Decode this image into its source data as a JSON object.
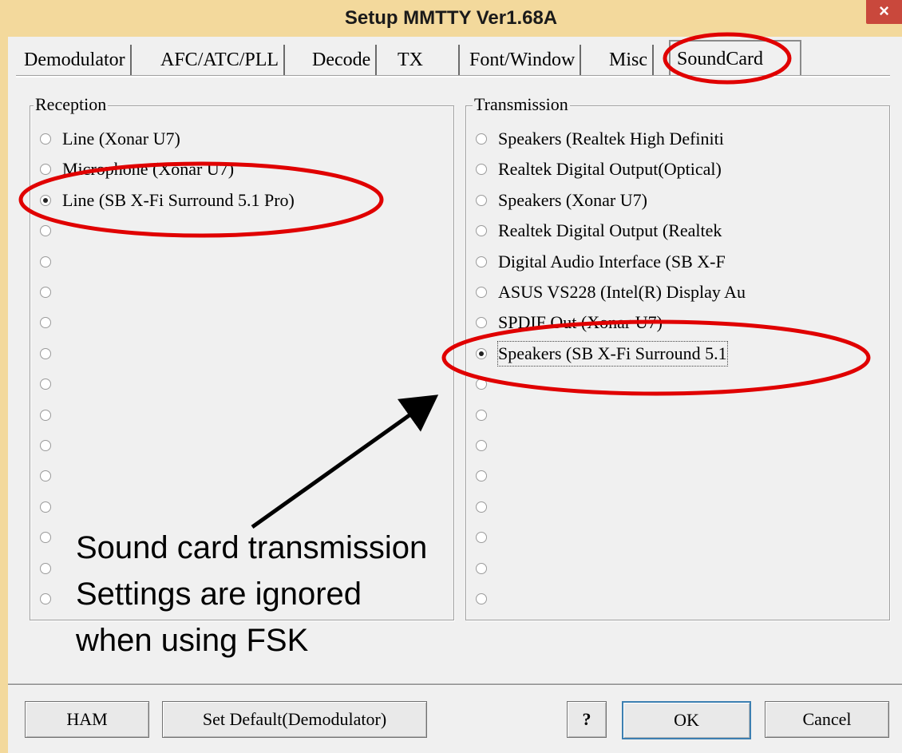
{
  "window": {
    "title": "Setup MMTTY Ver1.68A",
    "close_glyph": "×"
  },
  "tabs": [
    {
      "label": "Demodulator",
      "active": false
    },
    {
      "label": "AFC/ATC/PLL",
      "active": false
    },
    {
      "label": "Decode",
      "active": false
    },
    {
      "label": "TX",
      "active": false
    },
    {
      "label": "Font/Window",
      "active": false
    },
    {
      "label": "Misc",
      "active": false
    },
    {
      "label": "SoundCard",
      "active": true
    }
  ],
  "reception": {
    "label": "Reception",
    "options": [
      {
        "label": "Line (Xonar U7)",
        "checked": false
      },
      {
        "label": "Microphone (Xonar U7)",
        "checked": false
      },
      {
        "label": "Line (SB X-Fi Surround 5.1 Pro)",
        "checked": true
      },
      {
        "label": "",
        "checked": false
      },
      {
        "label": "",
        "checked": false
      },
      {
        "label": "",
        "checked": false
      },
      {
        "label": "",
        "checked": false
      },
      {
        "label": "",
        "checked": false
      },
      {
        "label": "",
        "checked": false
      },
      {
        "label": "",
        "checked": false
      },
      {
        "label": "",
        "checked": false
      },
      {
        "label": "",
        "checked": false
      },
      {
        "label": "",
        "checked": false
      },
      {
        "label": "",
        "checked": false
      },
      {
        "label": "",
        "checked": false
      },
      {
        "label": "",
        "checked": false
      }
    ]
  },
  "transmission": {
    "label": "Transmission",
    "options": [
      {
        "label": "Speakers (Realtek High Definiti",
        "checked": false
      },
      {
        "label": "Realtek Digital Output(Optical)",
        "checked": false
      },
      {
        "label": "Speakers (Xonar U7)",
        "checked": false
      },
      {
        "label": "Realtek Digital Output (Realtek",
        "checked": false
      },
      {
        "label": "Digital Audio Interface (SB X-F",
        "checked": false
      },
      {
        "label": "ASUS VS228 (Intel(R) Display Au",
        "checked": false
      },
      {
        "label": "SPDIF Out (Xonar U7)",
        "checked": false
      },
      {
        "label": "Speakers (SB X-Fi Surround 5.1",
        "checked": true
      },
      {
        "label": "",
        "checked": false
      },
      {
        "label": "",
        "checked": false
      },
      {
        "label": "",
        "checked": false
      },
      {
        "label": "",
        "checked": false
      },
      {
        "label": "",
        "checked": false
      },
      {
        "label": "",
        "checked": false
      },
      {
        "label": "",
        "checked": false
      },
      {
        "label": "",
        "checked": false
      }
    ]
  },
  "buttons": {
    "ham": "HAM",
    "set_default": "Set Default(Demodulator)",
    "help": "?",
    "ok": "OK",
    "cancel": "Cancel"
  },
  "annotation": {
    "line1": "Sound card transmission",
    "line2": "Settings are ignored",
    "line3": "when using FSK",
    "highlight_color": "#e00000",
    "arrow_color": "#000000"
  }
}
